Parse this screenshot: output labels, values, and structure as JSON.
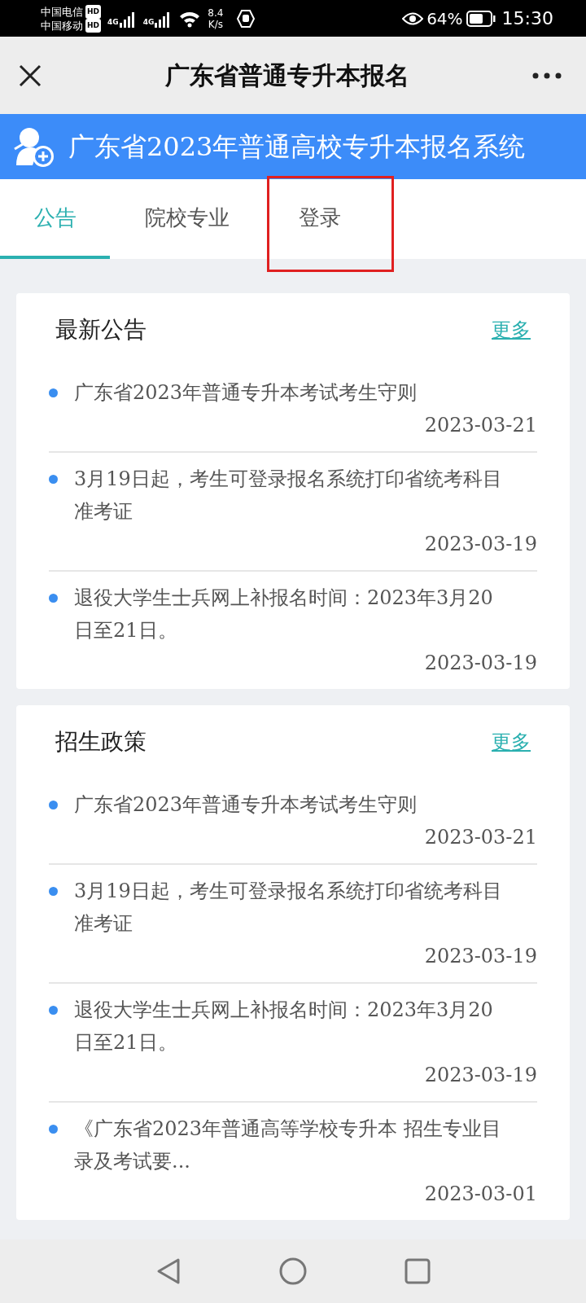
{
  "status_bar": {
    "carriers": [
      {
        "name": "中国电信",
        "badge": "HD"
      },
      {
        "name": "中国移动",
        "badge": "HD"
      }
    ],
    "signals": [
      "4G",
      "4G"
    ],
    "speed_value": "8.4",
    "speed_unit": "K/s",
    "battery": "64%",
    "time": "15:30"
  },
  "window": {
    "title": "广东省普通专升本报名"
  },
  "banner": {
    "title": "广东省2023年普通高校专升本报名系统"
  },
  "tabs": [
    {
      "label": "公告",
      "selected": true,
      "highlighted": false
    },
    {
      "label": "院校专业",
      "selected": false,
      "highlighted": false
    },
    {
      "label": "登录",
      "selected": false,
      "highlighted": true
    }
  ],
  "sections": [
    {
      "title": "最新公告",
      "more": "更多",
      "items": [
        {
          "title": "广东省2023年普通专升本考试考生守则",
          "date": "2023-03-21"
        },
        {
          "title": "3月19日起，考生可登录报名系统打印省统考科目准考证",
          "date": "2023-03-19"
        },
        {
          "title": "退役大学生士兵网上补报名时间：2023年3月20日至21日。",
          "date": "2023-03-19"
        }
      ]
    },
    {
      "title": "招生政策",
      "more": "更多",
      "items": [
        {
          "title": "广东省2023年普通专升本考试考生守则",
          "date": "2023-03-21"
        },
        {
          "title": "3月19日起，考生可登录报名系统打印省统考科目准考证",
          "date": "2023-03-19"
        },
        {
          "title": "退役大学生士兵网上补报名时间：2023年3月20日至21日。",
          "date": "2023-03-19"
        },
        {
          "title": "《广东省2023年普通高等学校专升本 招生专业目录及考试要...",
          "date": "2023-03-01"
        }
      ]
    }
  ]
}
